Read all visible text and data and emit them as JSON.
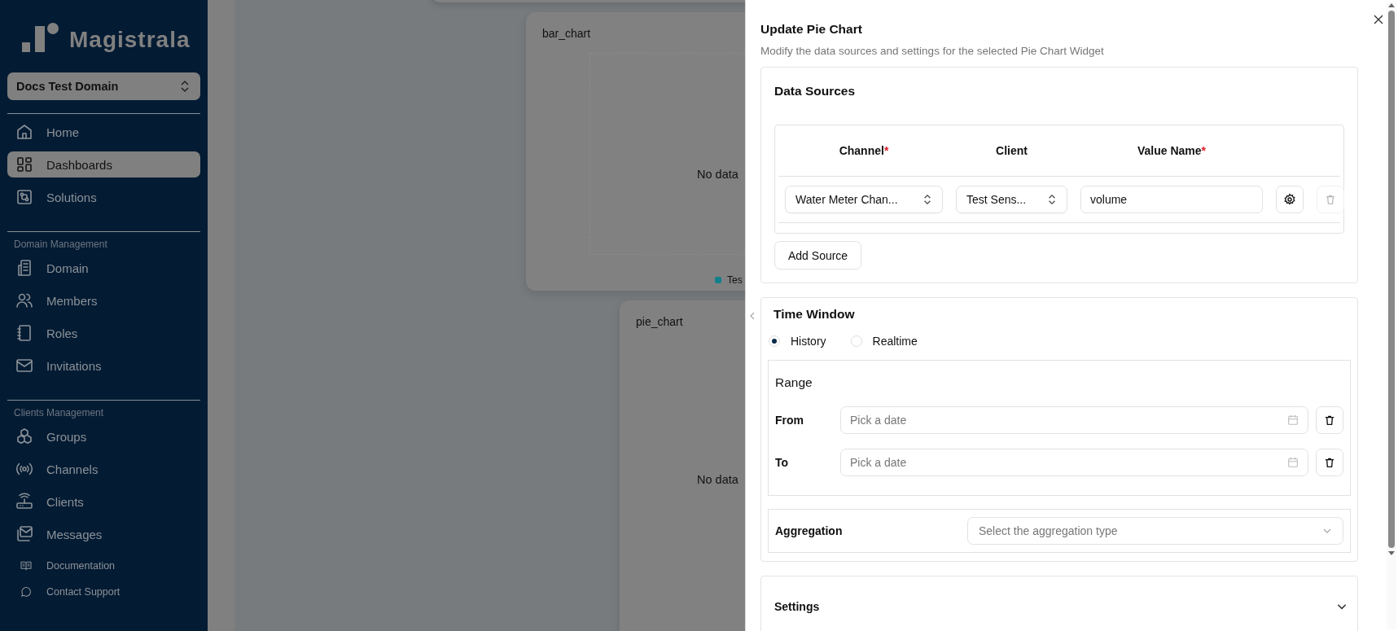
{
  "sidebar": {
    "logo": "Magistrala",
    "domain_selector": "Docs Test Domain",
    "groups": [
      {
        "items": [
          {
            "label": "Home",
            "selected": false
          },
          {
            "label": "Dashboards",
            "selected": true
          },
          {
            "label": "Solutions",
            "selected": false
          }
        ]
      },
      {
        "heading": "Domain Management",
        "items": [
          {
            "label": "Domain",
            "selected": false
          },
          {
            "label": "Members",
            "selected": false
          },
          {
            "label": "Roles",
            "selected": false
          },
          {
            "label": "Invitations",
            "selected": false
          }
        ]
      },
      {
        "heading": "Clients Management",
        "items": [
          {
            "label": "Groups",
            "selected": false
          },
          {
            "label": "Channels",
            "selected": false
          },
          {
            "label": "Clients",
            "selected": false
          },
          {
            "label": "Messages",
            "selected": false
          }
        ]
      }
    ],
    "footer_links": [
      "Documentation",
      "Contact Support"
    ]
  },
  "dashboard": {
    "widgets": [
      {
        "title": "bar_chart",
        "message": "No data",
        "legend": "Tes"
      },
      {
        "title": "pie_chart",
        "message": "No data"
      }
    ]
  },
  "sheet": {
    "title": "Update Pie Chart",
    "description": "Modify the data sources and settings for the selected Pie Chart Widget",
    "data_sources": {
      "heading": "Data Sources",
      "columns": [
        {
          "label": "Channel",
          "required_mark": "*"
        },
        {
          "label": "Client"
        },
        {
          "label": "Value Name",
          "required_mark": "*"
        }
      ],
      "rows": [
        {
          "channel": "Water Meter Chan...",
          "client": "Test Sens...",
          "value_name": "volume",
          "remove_disabled": true
        }
      ],
      "add_button": "Add Source"
    },
    "time_window": {
      "heading": "Time Window",
      "modes": [
        {
          "label": "History",
          "selected": true
        },
        {
          "label": "Realtime",
          "selected": false
        }
      ],
      "range": {
        "heading": "Range",
        "fields": [
          {
            "label": "From",
            "placeholder": "Pick a date"
          },
          {
            "label": "To",
            "placeholder": "Pick a date"
          }
        ]
      },
      "aggregation": {
        "label": "Aggregation",
        "placeholder": "Select the aggregation type"
      }
    },
    "settings": {
      "heading": "Settings",
      "expanded": false
    }
  }
}
